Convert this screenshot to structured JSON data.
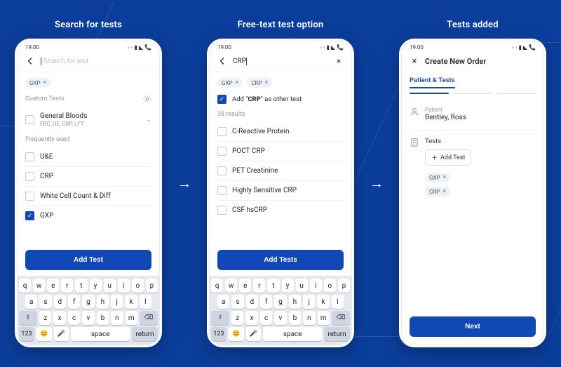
{
  "titles": {
    "s1": "Search for tests",
    "s2": "Free-text test option",
    "s3": "Tests added"
  },
  "status_time": "19:00",
  "keyboard": {
    "row1": [
      "q",
      "w",
      "e",
      "r",
      "t",
      "y",
      "u",
      "i",
      "o",
      "p"
    ],
    "row2": [
      "a",
      "s",
      "d",
      "f",
      "g",
      "h",
      "j",
      "k",
      "l"
    ],
    "row3_shift": "⇧",
    "row3": [
      "z",
      "x",
      "c",
      "v",
      "b",
      "n",
      "m"
    ],
    "row3_back": "⌫",
    "bottom_123": "123",
    "bottom_emoji": "😊",
    "bottom_mic": "🎤",
    "bottom_space": "space",
    "bottom_return": "return"
  },
  "s1": {
    "search_placeholder": "Search for test",
    "chips": [
      "GXP"
    ],
    "custom_header": "Custom Tests",
    "custom": {
      "title": "General Bloods",
      "sub": "FBC, UE, CRP, LFT"
    },
    "freq_header": "Frequently used",
    "freq": [
      {
        "label": "U&E",
        "checked": false
      },
      {
        "label": "CRP",
        "checked": false
      },
      {
        "label": "White Cell Count & Diff",
        "checked": false
      },
      {
        "label": "GXP",
        "checked": true
      }
    ],
    "button": "Add Test"
  },
  "s2": {
    "search_value": "CRP",
    "chips": [
      "GXP",
      "CRP"
    ],
    "add_other_prefix": "Add \"",
    "add_other_term": "CRP",
    "add_other_suffix": "\" as other test",
    "results_header": "38 results",
    "results": [
      "C-Reactive Protein",
      "POCT CRP",
      "PET Creatinine",
      "Highly Sensitive CRP",
      "CSF hsCRP"
    ],
    "button": "Add Tests"
  },
  "s3": {
    "title": "Create New Order",
    "tab": "Patient & Tests",
    "patient_label": "Patient",
    "patient_name": "Bentley, Ross",
    "tests_label": "Tests",
    "add_test_btn": "Add Test",
    "chips": [
      "GXP",
      "CRP"
    ],
    "button": "Next"
  }
}
